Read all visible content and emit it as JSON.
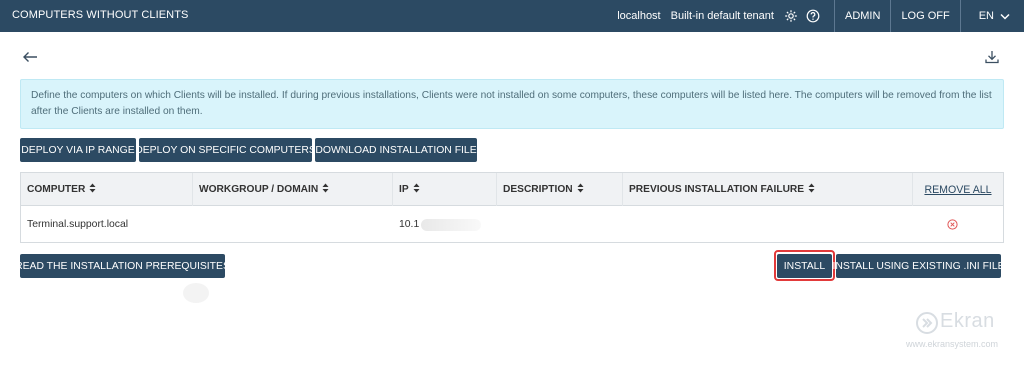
{
  "header": {
    "title": "COMPUTERS WITHOUT CLIENTS",
    "host": "localhost",
    "tenant": "Built-in default tenant",
    "admin_label": "ADMIN",
    "logoff_label": "LOG OFF",
    "language": "EN"
  },
  "info_text": "Define the computers on which Clients will be installed. If during previous installations, Clients were not installed on some computers, these computers will be listed here. The computers will be removed from the list after the Clients are installed on them.",
  "actions": {
    "deploy_ip_range": "DEPLOY VIA IP RANGE",
    "deploy_specific": "DEPLOY ON SPECIFIC COMPUTERS",
    "download_file": "DOWNLOAD INSTALLATION FILE"
  },
  "table": {
    "columns": {
      "computer": "COMPUTER",
      "workgroup": "WORKGROUP / DOMAIN",
      "ip": "IP",
      "description": "DESCRIPTION",
      "failure": "PREVIOUS INSTALLATION FAILURE",
      "remove_all": "REMOVE ALL"
    },
    "rows": [
      {
        "computer": "Terminal.support.local",
        "workgroup": "",
        "ip": "10.1",
        "description": "",
        "failure": ""
      }
    ]
  },
  "footer_actions": {
    "prerequisites": "READ THE INSTALLATION PREREQUISITES",
    "install": "INSTALL",
    "install_ini": "INSTALL USING EXISTING .INI FILE"
  },
  "watermark": {
    "name": "Ekran",
    "url": "www.ekransystem.com"
  },
  "colors": {
    "header_bg": "#2c4a63",
    "button_bg": "#2c4a63",
    "info_bg": "#d9f4fb",
    "highlight": "#e23a3a",
    "remove_icon": "#e05656"
  },
  "icons": [
    "settings-gear-icon",
    "help-icon",
    "chevron-down-icon",
    "back-arrow-icon",
    "download-icon",
    "sort-icon",
    "remove-circle-icon",
    "ekran-logo-icon"
  ]
}
